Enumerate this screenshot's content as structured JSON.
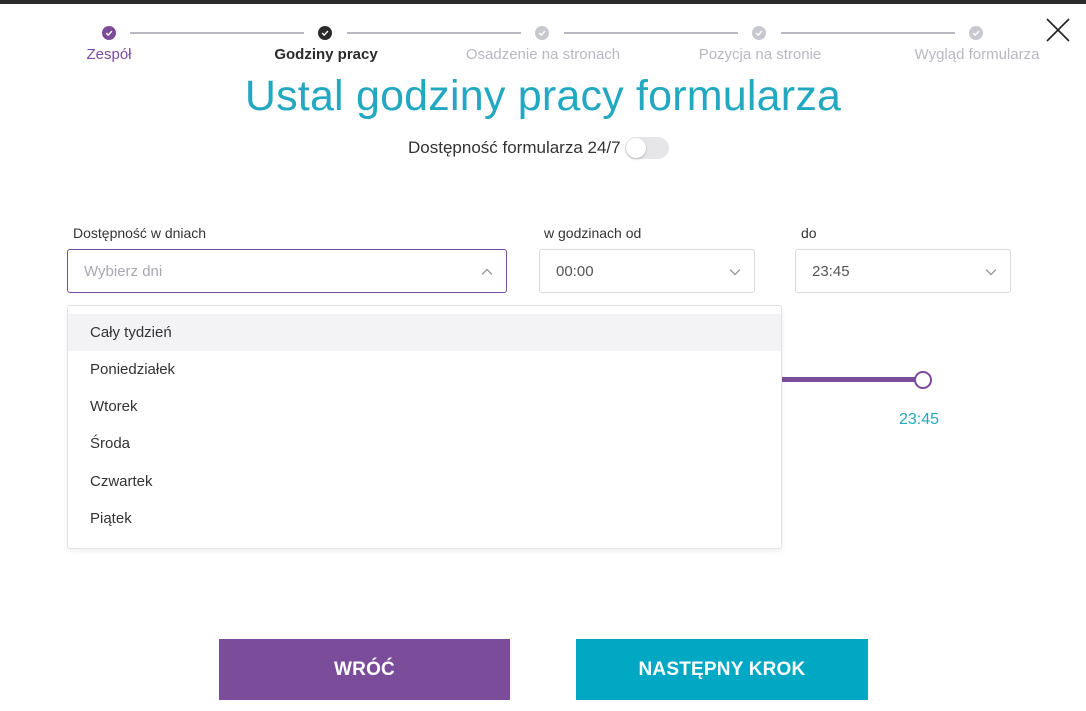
{
  "stepper": {
    "steps": [
      {
        "label": "Zespół",
        "state": "done"
      },
      {
        "label": "Godziny pracy",
        "state": "current"
      },
      {
        "label": "Osadzenie na stronach",
        "state": "todo"
      },
      {
        "label": "Pozycja na stronie",
        "state": "todo"
      },
      {
        "label": "Wygląd formularza",
        "state": "todo"
      }
    ]
  },
  "title": "Ustal godziny pracy formularza",
  "availability_toggle": {
    "label": "Dostępność formularza 24/7",
    "on": false
  },
  "days_field": {
    "label": "Dostępność w dniach",
    "placeholder": "Wybierz dni",
    "open": true
  },
  "from_field": {
    "label": "w godzinach od",
    "value": "00:00"
  },
  "to_field": {
    "label": "do",
    "value": "23:45"
  },
  "days_options": [
    "Cały tydzień",
    "Poniedziałek",
    "Wtorek",
    "Środa",
    "Czwartek",
    "Piątek"
  ],
  "slider": {
    "end_label": "23:45"
  },
  "buttons": {
    "back": "WRÓĆ",
    "next": "NASTĘPNY KROK"
  },
  "colors": {
    "purple": "#7b4c9a",
    "teal": "#22a8c0",
    "button_teal": "#00a8c4"
  }
}
